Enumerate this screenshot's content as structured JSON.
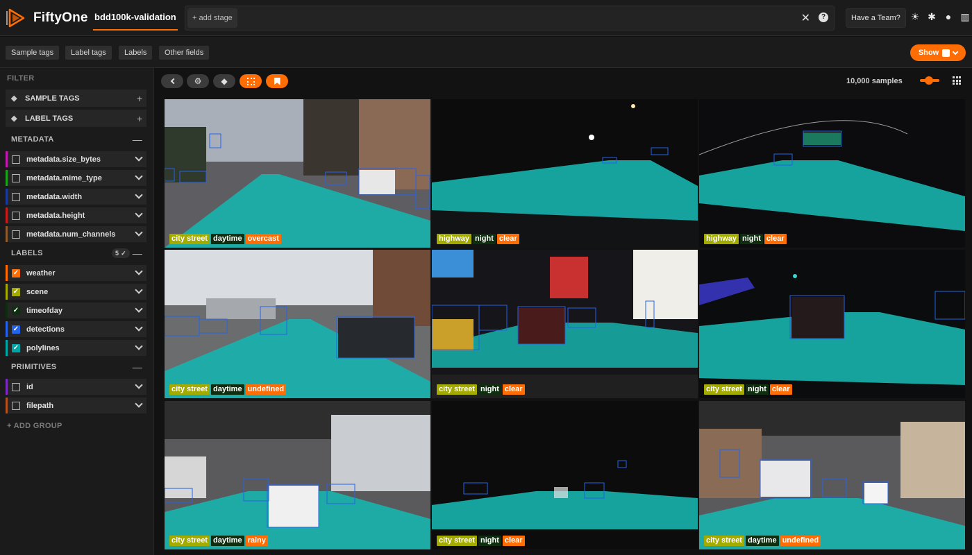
{
  "app": {
    "name": "FiftyOne",
    "dataset": "bdd100k-validation"
  },
  "viewbar": {
    "add_stage": "+ add stage",
    "help": "?"
  },
  "header": {
    "team_button": "Have a Team?",
    "icons": [
      "sun-icon",
      "slack-icon",
      "github-icon",
      "docs-icon"
    ]
  },
  "field_tabs": [
    "Sample tags",
    "Label tags",
    "Labels",
    "Other fields"
  ],
  "show_button": "Show",
  "sidebar": {
    "filter_title": "FILTER",
    "sample_tags": "SAMPLE TAGS",
    "label_tags": "LABEL TAGS",
    "metadata_group": "METADATA",
    "metadata_fields": [
      {
        "name": "metadata.size_bytes",
        "color": "#c21ab0"
      },
      {
        "name": "metadata.mime_type",
        "color": "#1aa31a"
      },
      {
        "name": "metadata.width",
        "color": "#1a3a9c"
      },
      {
        "name": "metadata.height",
        "color": "#c81c1c"
      },
      {
        "name": "metadata.num_channels",
        "color": "#8c5a2b"
      }
    ],
    "labels_group": "LABELS",
    "labels_badge": "5 ✓",
    "label_fields": [
      {
        "name": "weather",
        "color": "#ff6d04",
        "checked": true
      },
      {
        "name": "scene",
        "color": "#a3ab00",
        "checked": true
      },
      {
        "name": "timeofday",
        "color": "#0f2e10",
        "checked": true
      },
      {
        "name": "detections",
        "color": "#2463eb",
        "checked": true
      },
      {
        "name": "polylines",
        "color": "#00a6a6",
        "checked": true
      }
    ],
    "primitives_group": "PRIMITIVES",
    "primitive_fields": [
      {
        "name": "id",
        "color": "#7b2cbf"
      },
      {
        "name": "filepath",
        "color": "#b3501b"
      }
    ],
    "add_group": "+ ADD GROUP"
  },
  "grid": {
    "sample_count": "10,000 samples",
    "zoom": 0.5,
    "samples": [
      {
        "scene": "city street",
        "timeofday": "daytime",
        "weather": "overcast"
      },
      {
        "scene": "highway",
        "timeofday": "night",
        "weather": "clear"
      },
      {
        "scene": "highway",
        "timeofday": "night",
        "weather": "clear"
      },
      {
        "scene": "city street",
        "timeofday": "daytime",
        "weather": "undefined"
      },
      {
        "scene": "city street",
        "timeofday": "night",
        "weather": "clear"
      },
      {
        "scene": "city street",
        "timeofday": "night",
        "weather": "clear"
      },
      {
        "scene": "city street",
        "timeofday": "daytime",
        "weather": "rainy"
      },
      {
        "scene": "city street",
        "timeofday": "night",
        "weather": "clear"
      },
      {
        "scene": "city street",
        "timeofday": "daytime",
        "weather": "undefined"
      }
    ]
  },
  "colors": {
    "accent": "#ff6d04",
    "lane": "#17b3ad",
    "box": "#2463eb"
  }
}
